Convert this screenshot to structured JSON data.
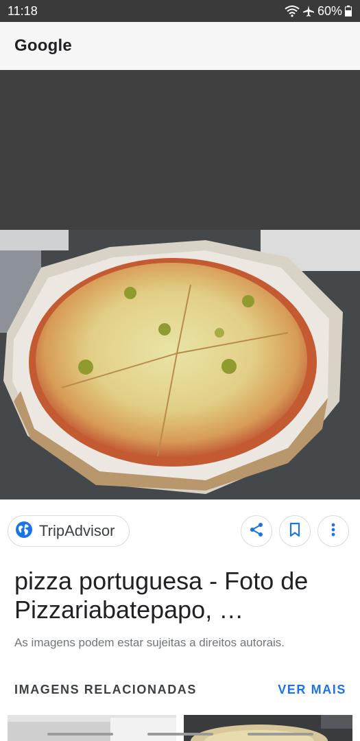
{
  "status_bar": {
    "time": "11:18",
    "battery": "60%",
    "icons": [
      "wifi-icon",
      "airplane-mode-icon",
      "battery-icon"
    ]
  },
  "app_bar": {
    "title": "Google"
  },
  "image_viewer": {
    "subject": "pizza-photo"
  },
  "source": {
    "name": "TripAdvisor",
    "icon": "globe-icon"
  },
  "actions": [
    {
      "name": "share",
      "icon": "share-icon"
    },
    {
      "name": "save",
      "icon": "bookmark-icon"
    },
    {
      "name": "more",
      "icon": "more-vert-icon"
    }
  ],
  "result": {
    "title": "pizza portuguesa - Foto de Pizzariabatepapo, …",
    "copyright_notice": "As imagens podem estar sujeitas a direitos autorais."
  },
  "related": {
    "header": "IMAGENS RELACIONADAS",
    "see_more": "VER MAIS"
  },
  "colors": {
    "accent": "#1a73e8",
    "status_bar": "#3a3a3a",
    "viewer_background": "#404040",
    "app_bar": "#f6f6f6"
  }
}
